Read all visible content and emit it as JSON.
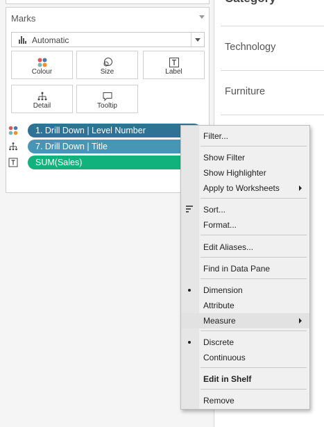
{
  "marks": {
    "title": "Marks",
    "mark_type": "Automatic",
    "buttons": {
      "colour": "Colour",
      "size": "Size",
      "label": "Label",
      "detail": "Detail",
      "tooltip": "Tooltip"
    },
    "pills": [
      {
        "label": "1. Drill Down | Level Number",
        "icon": "colour-icon",
        "color": "#2e7395"
      },
      {
        "label": "7. Drill Down | Title",
        "icon": "detail-icon",
        "color": "#4896b6"
      },
      {
        "label": "SUM(Sales)",
        "icon": "label-icon",
        "color": "#12b27c"
      }
    ]
  },
  "view": {
    "header_partial": "Category",
    "rows": [
      "Technology",
      "Furniture"
    ]
  },
  "context_menu": {
    "items": {
      "filter": "Filter...",
      "show_filter": "Show Filter",
      "show_highlighter": "Show Highlighter",
      "apply_to_worksheets": "Apply to Worksheets",
      "sort": "Sort...",
      "format": "Format...",
      "edit_aliases": "Edit Aliases...",
      "find_in_data_pane": "Find in Data Pane",
      "dimension": "Dimension",
      "attribute": "Attribute",
      "measure": "Measure",
      "discrete": "Discrete",
      "continuous": "Continuous",
      "edit_in_shelf": "Edit in Shelf",
      "remove": "Remove"
    },
    "checked": [
      "Dimension",
      "Discrete"
    ],
    "highlighted": "Measure"
  },
  "colors": {
    "pill_dark": "#2e7395",
    "pill_light": "#4896b6",
    "pill_measure": "#12b27c",
    "menu_bg": "#f0f0f0"
  }
}
